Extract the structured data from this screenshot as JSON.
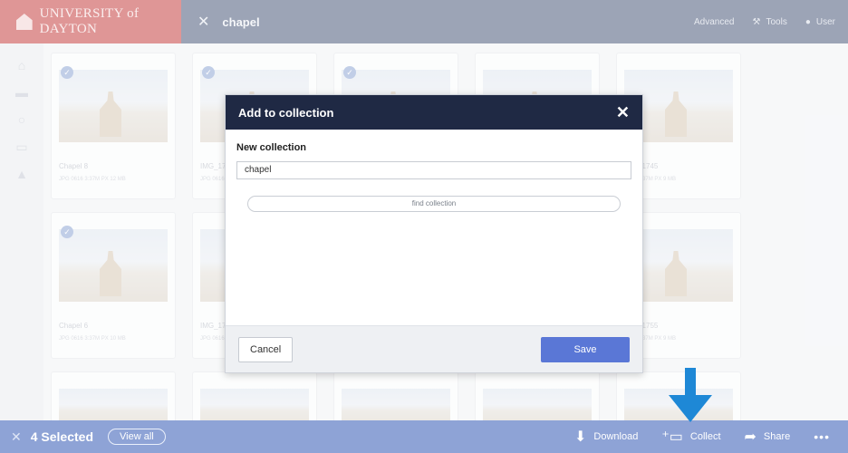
{
  "header": {
    "brand": "UNIVERSITY of DAYTON",
    "search_term": "chapel",
    "advanced": "Advanced",
    "tools": "Tools",
    "user": "User"
  },
  "grid": {
    "cards": [
      {
        "caption": "Chapel 8",
        "meta": "JPG  0616 3:37M PX  12 MB"
      },
      {
        "caption": "IMG_173",
        "meta": "JPG  0616"
      },
      {
        "caption": "",
        "meta": ""
      },
      {
        "caption": "",
        "meta": ""
      },
      {
        "caption": "IMG_1745",
        "meta": "0616 3:37M PX  9 MB"
      },
      {
        "caption": "Chapel 6",
        "meta": "JPG  0616 3:37M PX  10 MB"
      },
      {
        "caption": "IMG_173",
        "meta": "JPG  0616"
      },
      {
        "caption": "",
        "meta": ""
      },
      {
        "caption": "",
        "meta": ""
      },
      {
        "caption": "IMG_1755",
        "meta": "0616 3:37M PX  9 MB"
      }
    ]
  },
  "modal": {
    "title": "Add to collection",
    "close": "✕",
    "label": "New collection",
    "input_value": "chapel",
    "find_label": "find collection",
    "cancel_label": "Cancel",
    "save_label": "Save"
  },
  "bottombar": {
    "close": "✕",
    "selected": "4 Selected",
    "view_all": "View all",
    "download": "Download",
    "collect": "Collect",
    "share": "Share",
    "more": "•••"
  },
  "colors": {
    "header_bg": "#4c5a7a",
    "modal_header": "#1f2944",
    "accent": "#5a77d6",
    "arrow": "#1e88d6"
  }
}
